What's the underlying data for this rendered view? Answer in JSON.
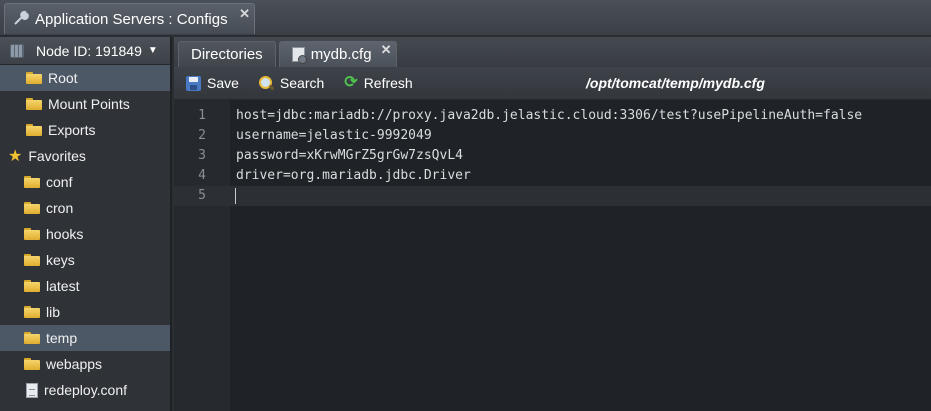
{
  "window": {
    "title": "Application Servers : Configs",
    "close_label": "✕"
  },
  "sidebar": {
    "node_label": "Node ID: 191849",
    "top_items": [
      {
        "label": "Root",
        "icon": "folder-icon",
        "selected": true
      },
      {
        "label": "Mount Points",
        "icon": "folder-icon"
      },
      {
        "label": "Exports",
        "icon": "folder-icon"
      }
    ],
    "favorites_label": "Favorites",
    "favorites": [
      {
        "label": "conf",
        "icon": "folder-icon"
      },
      {
        "label": "cron",
        "icon": "folder-icon"
      },
      {
        "label": "hooks",
        "icon": "folder-icon"
      },
      {
        "label": "keys",
        "icon": "folder-icon"
      },
      {
        "label": "latest",
        "icon": "folder-icon"
      },
      {
        "label": "lib",
        "icon": "folder-icon"
      },
      {
        "label": "temp",
        "icon": "folder-icon",
        "selected": true
      },
      {
        "label": "webapps",
        "icon": "folder-icon"
      },
      {
        "label": "redeploy.conf",
        "icon": "file-icon"
      }
    ]
  },
  "tabs": [
    {
      "label": "Directories"
    },
    {
      "label": "mydb.cfg",
      "active": true
    }
  ],
  "toolbar": {
    "save_label": "Save",
    "search_label": "Search",
    "refresh_label": "Refresh",
    "path": "/opt/tomcat/temp/mydb.cfg"
  },
  "editor": {
    "lines": [
      {
        "num": "1",
        "text": "host=jdbc:mariadb://proxy.java2db.jelastic.cloud:3306/test?usePipelineAuth=false"
      },
      {
        "num": "2",
        "text": "username=jelastic-9992049"
      },
      {
        "num": "3",
        "text": "password=xKrwMGrZ5grGw7zsQvL4"
      },
      {
        "num": "4",
        "text": "driver=org.mariadb.jdbc.Driver"
      },
      {
        "num": "5",
        "text": ""
      }
    ]
  },
  "colors": {
    "selection": "#4d5866",
    "background": "#1f2226",
    "folder": "#f5d56c"
  }
}
